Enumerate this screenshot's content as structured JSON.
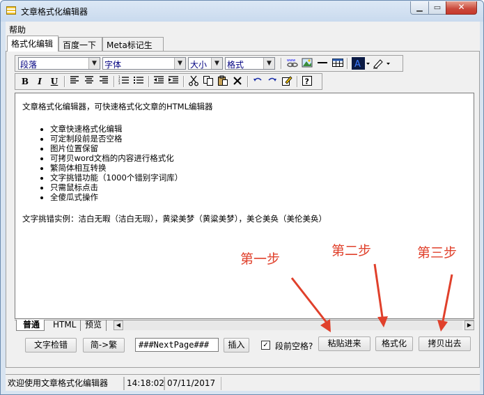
{
  "window": {
    "title": "文章格式化编辑器"
  },
  "titlebar_buttons": {
    "minimize": "▁",
    "maximize": "▭",
    "close": "✕"
  },
  "menu": {
    "help": "帮助"
  },
  "tabs": [
    {
      "label": "格式化编辑",
      "active": true
    },
    {
      "label": "百度一下",
      "active": false
    },
    {
      "label": "Meta标记生成",
      "active": false
    }
  ],
  "toolbar1": {
    "paragraph_select": "段落",
    "font_select": "字体",
    "size_select": "大小",
    "format_select": "格式",
    "icons": [
      "link-icon",
      "image-icon",
      "horizontal-rule-icon",
      "table-icon",
      "font-color-icon",
      "highlight-icon"
    ]
  },
  "toolbar2": {
    "bold": "B",
    "italic": "I",
    "underline": "U",
    "icons": [
      "align-left-icon",
      "align-center-icon",
      "align-right-icon",
      "ordered-list-icon",
      "unordered-list-icon",
      "outdent-icon",
      "indent-icon",
      "cut-icon",
      "copy-icon",
      "paste-icon",
      "delete-icon",
      "undo-icon",
      "redo-icon",
      "edit-icon",
      "help-icon"
    ]
  },
  "editor": {
    "intro": "文章格式化编辑器，可快速格式化文章的HTML编辑器",
    "features": [
      "文章快速格式化编辑",
      "可定制段前是否空格",
      "图片位置保留",
      "可拷贝word文档的内容进行格式化",
      "繁简体相互转换",
      "文字挑错功能（1000个错别字词库）",
      "只需鼠标点击",
      "全傻瓜式操作"
    ],
    "example": "文字挑错实例：洁白无暇（洁白无瑕），黄梁美梦（黄粱美梦），美仑美奂（美伦美奂）"
  },
  "annotations": {
    "step1": "第一步",
    "step2": "第二步",
    "step3": "第三步",
    "arrow_color": "#e0402b"
  },
  "view_tabs": [
    {
      "label": "普通",
      "active": true
    },
    {
      "label": "HTML",
      "active": false
    },
    {
      "label": "预览",
      "active": false
    }
  ],
  "actions": {
    "spellcheck": "文字检错",
    "convert": "简->繁",
    "nextpage_value": "###NextPage###",
    "insert": "插入",
    "indent_checkbox_checked": true,
    "indent_label": "段前空格?",
    "paste": "粘贴进来",
    "format": "格式化",
    "copy_out": "拷贝出去"
  },
  "status": {
    "message": "欢迎使用文章格式化编辑器",
    "time": "14:18:02",
    "date": "07/11/2017"
  }
}
